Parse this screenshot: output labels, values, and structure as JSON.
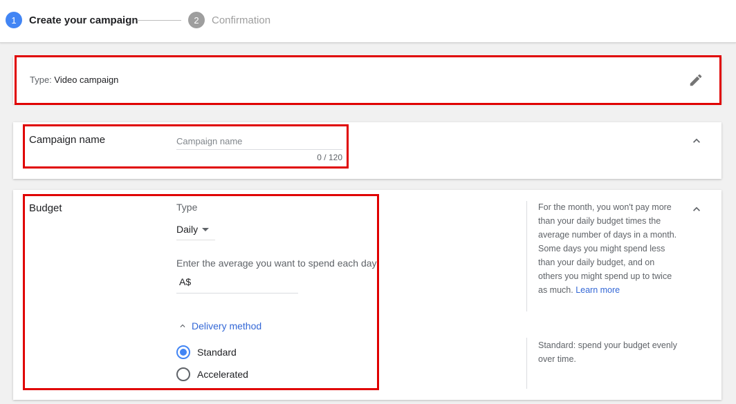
{
  "stepper": {
    "step1": {
      "number": "1",
      "label": "Create your campaign"
    },
    "step2": {
      "number": "2",
      "label": "Confirmation"
    }
  },
  "type_card": {
    "prefix": "Type:",
    "value": "Video campaign",
    "edit_icon": "pencil-icon"
  },
  "campaign_name": {
    "title": "Campaign name",
    "placeholder": "Campaign name",
    "value": "",
    "counter": "0 / 120",
    "collapse_icon": "chevron-up-icon"
  },
  "budget": {
    "title": "Budget",
    "type_label": "Type",
    "type_value": "Daily",
    "avg_label": "Enter the average you want to spend each day",
    "currency": "A$",
    "amount": "",
    "delivery_label": "Delivery method",
    "options": [
      {
        "label": "Standard",
        "checked": true
      },
      {
        "label": "Accelerated",
        "checked": false
      }
    ],
    "help_text": "For the month, you won't pay more than your daily budget times the average number of days in a month. Some days you might spend less than your daily budget, and on others you might spend up to twice as much.",
    "learn_more": "Learn more",
    "standard_help": "Standard: spend your budget evenly over time."
  },
  "colors": {
    "accent": "#4285f4",
    "link": "#3367d6",
    "highlight": "#e00000",
    "inactive_step": "#9e9e9e"
  }
}
